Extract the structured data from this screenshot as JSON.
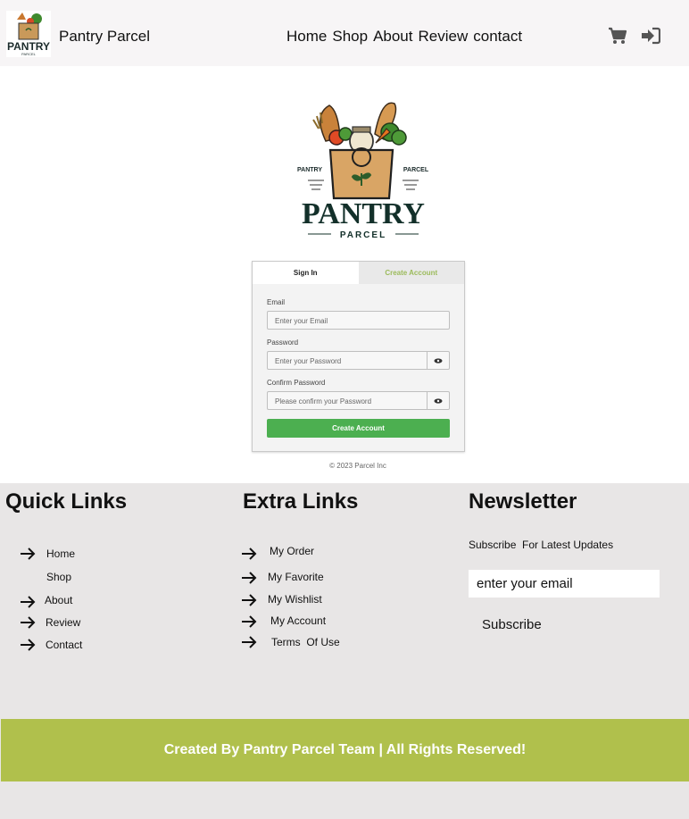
{
  "header": {
    "brand": "Pantry Parcel",
    "nav": [
      "Home",
      "Shop",
      "About",
      "Review",
      "contact"
    ],
    "logo_text": "PANTRY",
    "logo_subtext": "PARCEL"
  },
  "logo": {
    "left_tag": "PANTRY",
    "right_tag": "PARCEL",
    "word1": "PANTRY",
    "word2": "PARCEL"
  },
  "auth": {
    "tab_signin": "Sign In",
    "tab_create": "Create Account",
    "email_label": "Email",
    "email_placeholder": "Enter your Email",
    "password_label": "Password",
    "password_placeholder": "Enter your Password",
    "confirm_label": "Confirm Password",
    "confirm_placeholder": "Please confirm your Password",
    "submit": "Create Account",
    "copyright": "© 2023 Parcel Inc"
  },
  "quick_links": {
    "title": "Quick Links",
    "items": [
      "Home",
      "Shop",
      "About",
      "Review",
      "Contact"
    ]
  },
  "extra_links": {
    "title": "Extra Links",
    "items": [
      "My Order",
      "My Favorite",
      "My Wishlist",
      "My Account",
      "Terms  Of Use"
    ]
  },
  "newsletter": {
    "title": "Newsletter",
    "text": "Subscribe  For Latest Updates",
    "placeholder": "enter your email",
    "button": "Subscribe"
  },
  "footer": {
    "credit": "Created By Pantry Parcel Team | All Rights Reserved!"
  },
  "colors": {
    "accent_green": "#4caf50",
    "footer_olive": "#b0c04c",
    "tab_green": "#9cbb5c"
  }
}
